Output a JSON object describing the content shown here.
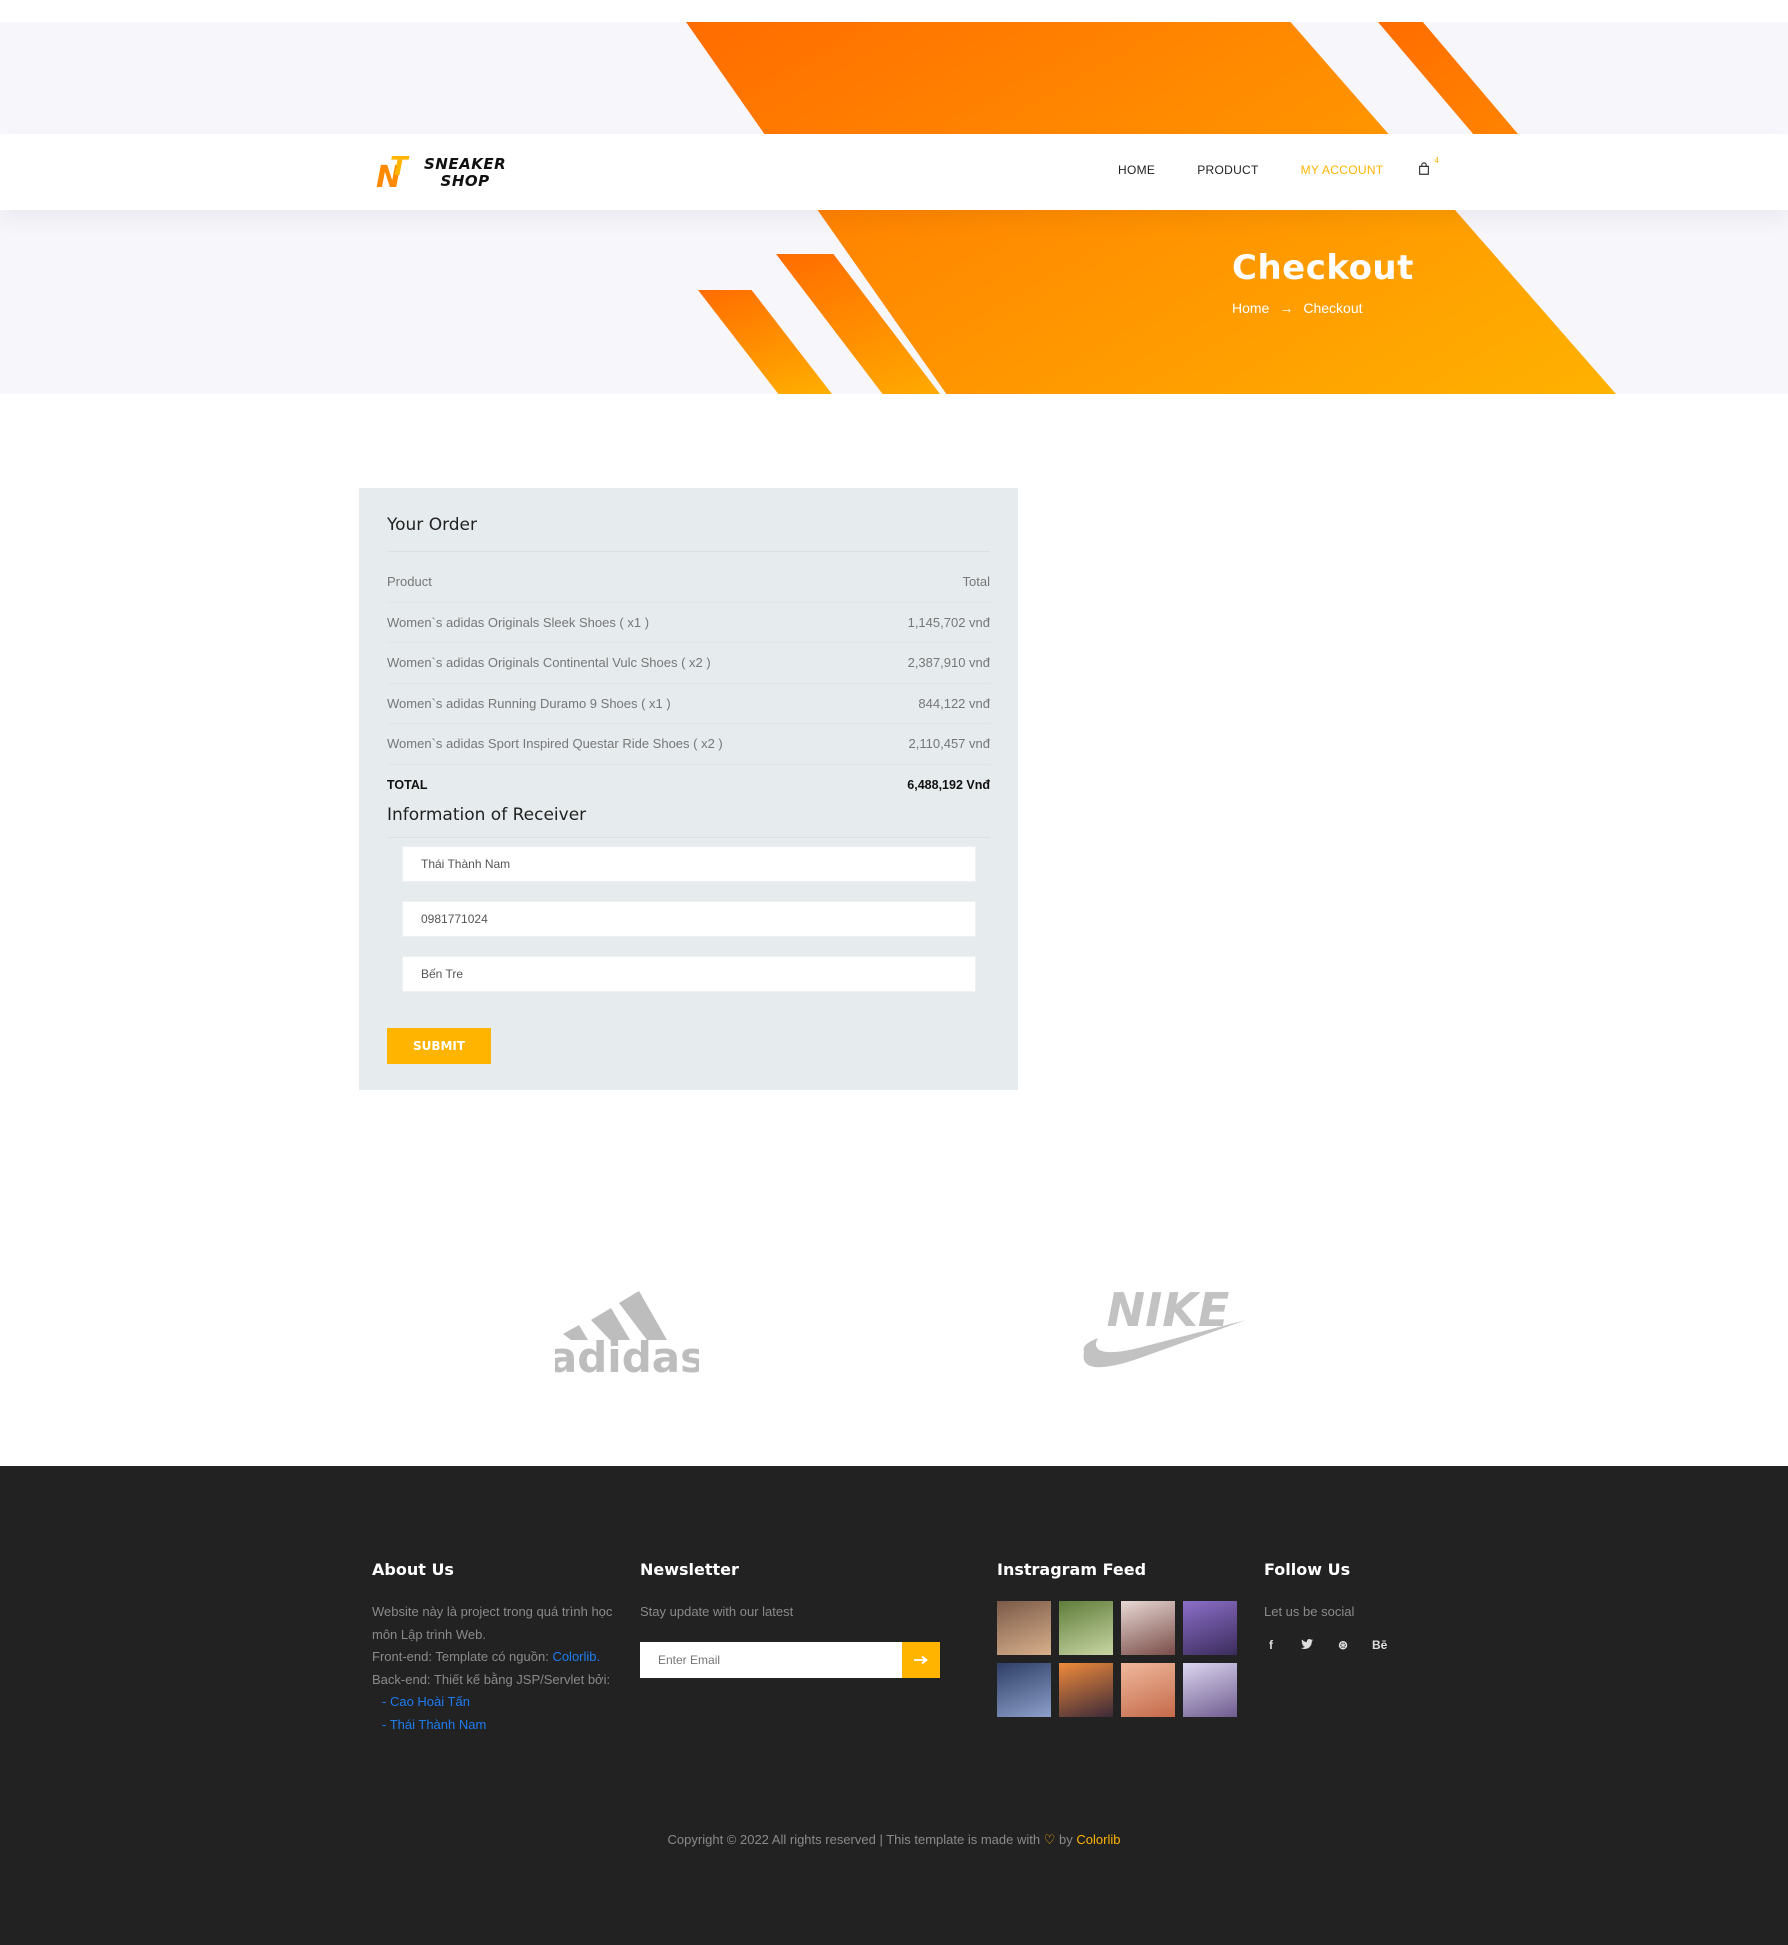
{
  "header": {
    "logo_line1": "SNEAKER",
    "logo_line2": "SHOP",
    "logo_mark_n": "N",
    "logo_mark_t": "T",
    "nav": [
      {
        "label": "HOME"
      },
      {
        "label": "PRODUCT"
      },
      {
        "label": "MY ACCOUNT",
        "active": true
      }
    ],
    "cart_count": "4"
  },
  "banner": {
    "title": "Checkout",
    "breadcrumb_home": "Home",
    "breadcrumb_arrow": "→",
    "breadcrumb_current": "Checkout"
  },
  "order": {
    "title": "Your Order",
    "col_product": "Product",
    "col_total": "Total",
    "items": [
      {
        "name": "Women`s adidas Originals Sleek Shoes ( x1 )",
        "price": "1,145,702 vnđ"
      },
      {
        "name": "Women`s adidas Originals Continental Vulc Shoes ( x2 )",
        "price": "2,387,910 vnđ"
      },
      {
        "name": "Women`s adidas Running Duramo 9 Shoes ( x1 )",
        "price": "844,122 vnđ"
      },
      {
        "name": "Women`s adidas Sport Inspired Questar Ride Shoes ( x2 )",
        "price": "2,110,457 vnđ"
      }
    ],
    "total_label": "TOTAL",
    "total_value": "6,488,192 Vnđ"
  },
  "receiver": {
    "title": "Information of Receiver",
    "name_value": "Thái Thành Nam",
    "phone_value": "0981771024",
    "address_value": "Bến Tre",
    "submit_label": "SUBMIT"
  },
  "brands": [
    "adidas",
    "NIKE"
  ],
  "footer": {
    "about": {
      "title": "About Us",
      "line1": "Website này là project trong quá trình học môn Lập trình Web.",
      "frontend_prefix": "Front-end: Template có nguồn: ",
      "frontend_link": "Colorlib",
      "frontend_suffix": ".",
      "backend": "Back-end: Thiết kế bằng JSP/Servlet bởi:",
      "author_dash": "- ",
      "author1": "Cao Hoài Tấn",
      "author2": "Thái Thành Nam"
    },
    "newsletter": {
      "title": "Newsletter",
      "desc": "Stay update with our latest",
      "placeholder": "Enter Email",
      "button_icon": "long-arrow-right-icon"
    },
    "instagram": {
      "title": "Instragram Feed",
      "thumbs": [
        {
          "c1": "#7a5a48",
          "c2": "#d9b08c"
        },
        {
          "c1": "#5f7d3a",
          "c2": "#c9d6a4"
        },
        {
          "c1": "#e8d8d4",
          "c2": "#7a4d48"
        },
        {
          "c1": "#8c6fc9",
          "c2": "#3b2c5c"
        },
        {
          "c1": "#2e3e66",
          "c2": "#8da0c9"
        },
        {
          "c1": "#f08a3b",
          "c2": "#3b2a38"
        },
        {
          "c1": "#f0b89c",
          "c2": "#c46a4a"
        },
        {
          "c1": "#dcd6f0",
          "c2": "#6f5c8f"
        }
      ]
    },
    "follow": {
      "title": "Follow Us",
      "desc": "Let us be social",
      "icons": [
        {
          "name": "facebook-icon",
          "glyph": "f"
        },
        {
          "name": "twitter-icon",
          "glyph": "🐦"
        },
        {
          "name": "dribbble-icon",
          "glyph": "⊛"
        },
        {
          "name": "behance-icon",
          "glyph": "Bē"
        }
      ]
    },
    "copyright_prefix": "Copyright © 2022 All rights reserved | This template is made with",
    "copyright_heart": "♡",
    "copyright_by": "by",
    "copyright_link": "Colorlib"
  },
  "colors": {
    "accent": "#ffb400",
    "orange": "#ff6c00",
    "footer_bg": "#222222",
    "card_bg": "#e6ebed",
    "link_blue": "#1e7cf2"
  }
}
